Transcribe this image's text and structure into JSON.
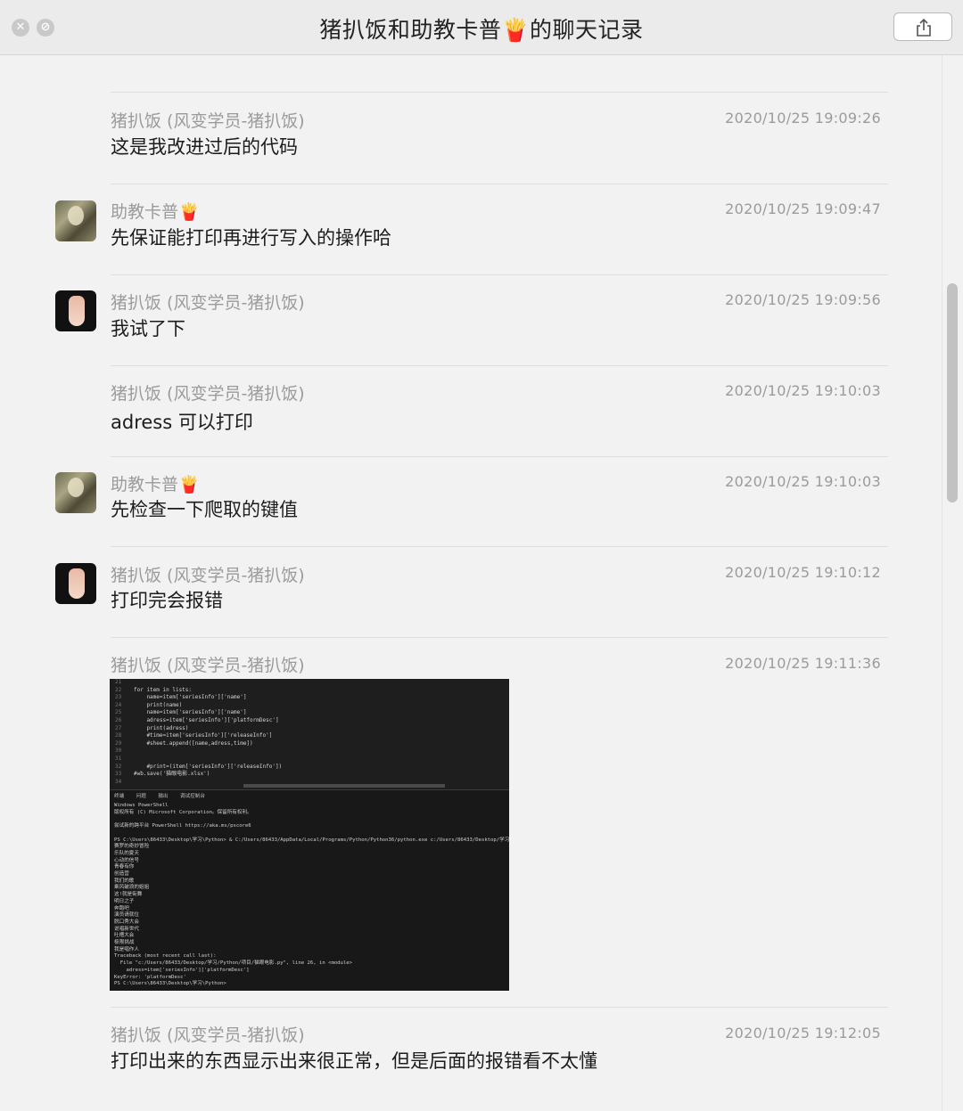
{
  "window": {
    "title": "猪扒饭和助教卡普🍟的聊天记录",
    "close_glyph": "✕",
    "minimize_glyph": "⊘",
    "share_icon": "share-icon"
  },
  "messages": [
    {
      "sender": "猪扒饭 (风变学员-猪扒饭)",
      "time": "2020/10/25 19:09:26",
      "text": "这是我改进过后的代码"
    },
    {
      "sender": "助教卡普🍟",
      "time": "2020/10/25 19:09:47",
      "text": "先保证能打印再进行写入的操作哈"
    },
    {
      "sender": "猪扒饭 (风变学员-猪扒饭)",
      "time": "2020/10/25 19:09:56",
      "text": "我试了下"
    },
    {
      "sender": "猪扒饭 (风变学员-猪扒饭)",
      "time": "2020/10/25 19:10:03",
      "text": "adress 可以打印"
    },
    {
      "sender": "助教卡普🍟",
      "time": "2020/10/25 19:10:03",
      "text": "先检查一下爬取的键值"
    },
    {
      "sender": "猪扒饭 (风变学员-猪扒饭)",
      "time": "2020/10/25 19:10:12",
      "text": "打印完会报错"
    },
    {
      "sender": "猪扒饭 (风变学员-猪扒饭)",
      "time": "2020/10/25 19:11:36",
      "text": ""
    },
    {
      "sender": "猪扒饭 (风变学员-猪扒饭)",
      "time": "2020/10/25 19:12:05",
      "text": "打印出来的东西显示出来很正常，但是后面的报错看不太懂"
    }
  ],
  "screenshot": {
    "line_numbers": "21\n22\n23\n24\n25\n26\n27\n28\n29\n30\n31\n32\n33\n34",
    "code": "\nfor item in lists:\n    name=item['seriesInfo']['name']\n    print(name)\n    name=item['seriesInfo']['name']\n    adress=item['seriesInfo']['platformDesc']\n    print(adress)\n    #time=item['seriesInfo']['releaseInfo']\n    #sheet.append([name,adress,time])\n\n\n    #print=(item['seriesInfo']['releaseInfo'])\n#wb.save('猫眼电影.xlsx')\n",
    "tabs": "终端    问题    输出    调试控制台",
    "terminal": "Windows PowerShell\n版权所有 (C) Microsoft Corporation。保留所有权利。\n\n尝试新的跨平台 PowerShell https://aka.ms/pscore6\n\nPS C:\\Users\\86433\\Desktop\\学习\\Python> & C:/Users/86433/AppData/Local/Programs/Python/Python36/python.exe c:/Users/86433/Desktop/学习/Pyth\n赛罗的奇妙冒险\n乐队的夏天\n心动的信号\n青春有你\n创造营\n我们的歌\n乘风破浪的姐姐\n这!就是街舞\n明日之子\n奔跑吧\n演员请就位\n脱口秀大会\n说唱新世代\n吐槽大会\n极限挑战\n我是唱作人\nTraceback (most recent call last):\n  File \"c:/Users/86433/Desktop/学习/Python/项目/猫眼电影.py\", line 26, in <module>\n    adress=item['seriesInfo']['platformDesc']\nKeyError: 'platformDesc'\nPS C:\\Users\\86433\\Desktop\\学习\\Python>"
  }
}
